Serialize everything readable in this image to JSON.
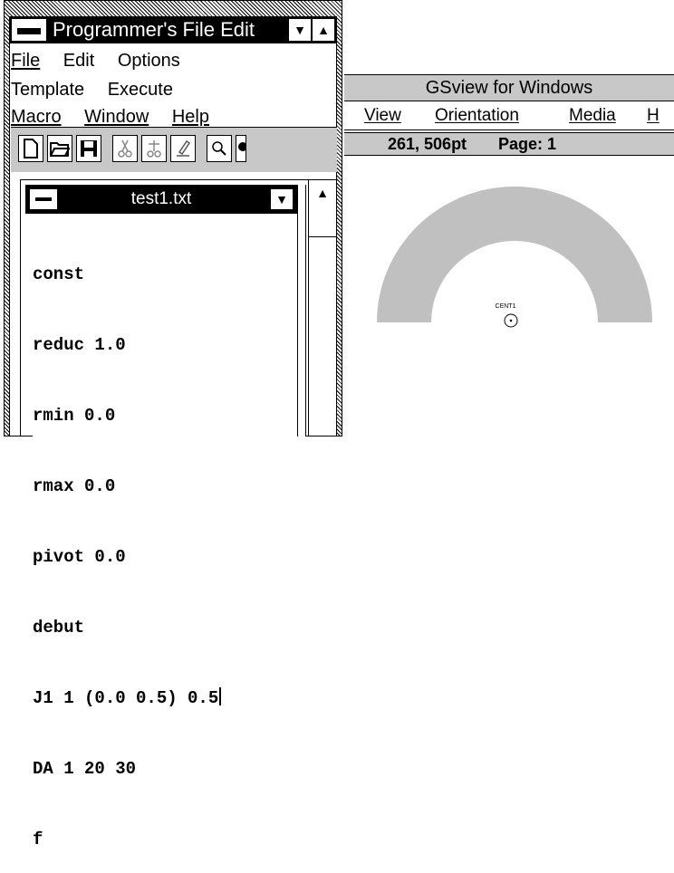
{
  "pfe": {
    "title": "Programmer's File Edit",
    "menus": {
      "row1": [
        "File",
        "Edit",
        "Options"
      ],
      "row2": [
        "Template",
        "Execute"
      ],
      "row3": [
        "Macro",
        "Window",
        "Help"
      ]
    },
    "toolbar": [
      "new-file-icon",
      "open-folder-icon",
      "save-disk-icon",
      "cut-scissors-icon",
      "copy-icon",
      "paste-brush-icon",
      "search-icon",
      "search-next-icon"
    ],
    "document": {
      "title": "test1.txt",
      "lines": [
        "const",
        "reduc 1.0",
        "rmin 0.0",
        "rmax 0.0",
        "pivot 0.0",
        "debut",
        "J1 1 (0.0 0.5) 0.5",
        "DA 1 20 30",
        "f"
      ]
    }
  },
  "gsview": {
    "title": "GSview for Windows",
    "menus": [
      "View",
      "Orientation",
      "Media",
      "H"
    ],
    "status": {
      "coords": "261, 506pt",
      "page": "Page: 1"
    },
    "canvas": {
      "label": "CENT1",
      "arch_color": "#c0c0c0"
    }
  },
  "colors": {
    "titlebar_active": "#000000",
    "panel_gray": "#c8c8c8"
  }
}
